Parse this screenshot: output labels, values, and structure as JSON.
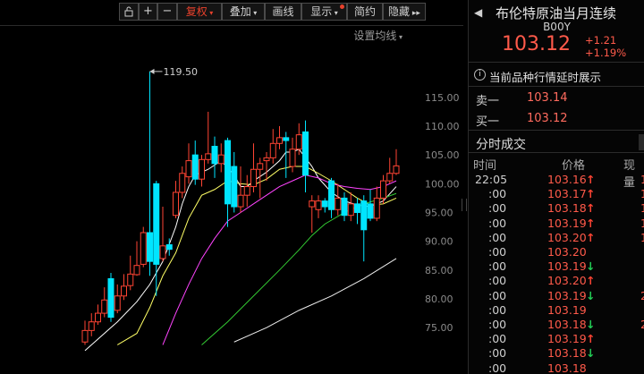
{
  "toolbar": {
    "buttons": [
      {
        "label": "复权",
        "has_menu": true,
        "active": true
      },
      {
        "label": "叠加",
        "has_menu": true
      },
      {
        "label": "画线",
        "has_menu": false
      },
      {
        "label": "显示",
        "has_menu": true,
        "dot": true
      },
      {
        "label": "简约",
        "has_menu": false
      },
      {
        "label": "隐藏",
        "has_menu": false
      }
    ],
    "icons": [
      "lock-icon",
      "plus-icon",
      "minus-icon"
    ],
    "collapse_icon": "double-chevron-right-icon",
    "avg_setting": "设置均线"
  },
  "colors": {
    "up": "#ff4433",
    "down": "#22cc55",
    "candle_up": "#ff4433",
    "candle_down": "#00e5ff",
    "ma5": "#ffffff",
    "ma10": "#ffff66",
    "ma20": "#ff44ff",
    "ma60": "#33cc33",
    "ma250": "#eeeeee"
  },
  "chart_data": {
    "type": "candlestick",
    "y_axis_labels": [
      "115.00",
      "110.00",
      "105.00",
      "100.00",
      "95.00",
      "90.00",
      "85.00",
      "80.00",
      "75.00"
    ],
    "ylim": [
      73,
      122
    ],
    "max_annotation": "119.50",
    "candles": [
      {
        "o": 72.5,
        "c": 74.5,
        "h": 76.2,
        "l": 72.0
      },
      {
        "o": 74.5,
        "c": 76.0,
        "h": 77.5,
        "l": 73.5
      },
      {
        "o": 76.0,
        "c": 77.5,
        "h": 79.0,
        "l": 75.5
      },
      {
        "o": 77.5,
        "c": 79.8,
        "h": 82.0,
        "l": 76.8
      },
      {
        "o": 83.5,
        "c": 76.8,
        "h": 84.5,
        "l": 76.0
      },
      {
        "o": 78.0,
        "c": 80.5,
        "h": 82.5,
        "l": 77.5
      },
      {
        "o": 80.5,
        "c": 82.2,
        "h": 84.3,
        "l": 79.8
      },
      {
        "o": 82.3,
        "c": 84.3,
        "h": 87.5,
        "l": 81.5
      },
      {
        "o": 84.2,
        "c": 85.8,
        "h": 90.0,
        "l": 84.0
      },
      {
        "o": 86.0,
        "c": 91.5,
        "h": 92.5,
        "l": 85.5
      },
      {
        "o": 91.5,
        "c": 86.5,
        "h": 119.5,
        "l": 84.0
      },
      {
        "o": 100.0,
        "c": 86.0,
        "h": 100.5,
        "l": 80.5
      },
      {
        "o": 87.0,
        "c": 89.2,
        "h": 96.0,
        "l": 86.5
      },
      {
        "o": 89.4,
        "c": 88.6,
        "h": 90.5,
        "l": 87.5
      },
      {
        "o": 94.5,
        "c": 98.5,
        "h": 100.5,
        "l": 94.0
      },
      {
        "o": 98.5,
        "c": 101.8,
        "h": 103.0,
        "l": 97.5
      },
      {
        "o": 101.2,
        "c": 104.0,
        "h": 107.0,
        "l": 100.0
      },
      {
        "o": 105.0,
        "c": 100.8,
        "h": 107.5,
        "l": 99.8
      },
      {
        "o": 100.8,
        "c": 104.2,
        "h": 105.0,
        "l": 99.5
      },
      {
        "o": 104.2,
        "c": 105.2,
        "h": 112.5,
        "l": 103.5
      },
      {
        "o": 106.5,
        "c": 103.5,
        "h": 108.2,
        "l": 101.0
      },
      {
        "o": 103.5,
        "c": 105.0,
        "h": 107.0,
        "l": 102.0
      },
      {
        "o": 107.5,
        "c": 96.5,
        "h": 108.0,
        "l": 92.5
      },
      {
        "o": 103.0,
        "c": 96.0,
        "h": 105.5,
        "l": 95.0
      },
      {
        "o": 96.0,
        "c": 98.0,
        "h": 103.0,
        "l": 95.0
      },
      {
        "o": 98.0,
        "c": 99.5,
        "h": 101.5,
        "l": 96.0
      },
      {
        "o": 99.5,
        "c": 102.5,
        "h": 107.0,
        "l": 98.5
      },
      {
        "o": 102.5,
        "c": 103.5,
        "h": 104.5,
        "l": 97.5
      },
      {
        "o": 104.0,
        "c": 104.5,
        "h": 105.5,
        "l": 100.5
      },
      {
        "o": 104.5,
        "c": 107.0,
        "h": 109.5,
        "l": 103.5
      },
      {
        "o": 107.0,
        "c": 108.0,
        "h": 110.0,
        "l": 106.0
      },
      {
        "o": 108.0,
        "c": 107.5,
        "h": 109.0,
        "l": 101.0
      },
      {
        "o": 103.0,
        "c": 106.0,
        "h": 108.0,
        "l": 102.0
      },
      {
        "o": 106.0,
        "c": 108.5,
        "h": 110.5,
        "l": 105.0
      },
      {
        "o": 109.0,
        "c": 101.5,
        "h": 111.0,
        "l": 98.5
      },
      {
        "o": 96.0,
        "c": 97.0,
        "h": 98.0,
        "l": 91.5
      },
      {
        "o": 95.5,
        "c": 97.0,
        "h": 98.0,
        "l": 94.0
      },
      {
        "o": 97.0,
        "c": 96.0,
        "h": 97.5,
        "l": 95.0
      },
      {
        "o": 100.5,
        "c": 95.5,
        "h": 101.0,
        "l": 94.0
      },
      {
        "o": 95.5,
        "c": 97.5,
        "h": 100.0,
        "l": 94.5
      },
      {
        "o": 97.5,
        "c": 94.5,
        "h": 98.5,
        "l": 93.5
      },
      {
        "o": 94.5,
        "c": 96.5,
        "h": 98.5,
        "l": 93.5
      },
      {
        "o": 96.5,
        "c": 95.0,
        "h": 97.5,
        "l": 93.0
      },
      {
        "o": 97.0,
        "c": 92.0,
        "h": 98.0,
        "l": 86.5
      },
      {
        "o": 96.5,
        "c": 94.0,
        "h": 99.0,
        "l": 93.5
      },
      {
        "o": 94.0,
        "c": 97.5,
        "h": 99.5,
        "l": 93.5
      },
      {
        "o": 97.5,
        "c": 100.5,
        "h": 101.5,
        "l": 96.5
      },
      {
        "o": 100.5,
        "c": 101.8,
        "h": 104.5,
        "l": 100.0
      },
      {
        "o": 101.8,
        "c": 103.1,
        "h": 106.0,
        "l": 101.5
      }
    ],
    "ma": [
      {
        "name": "MA5",
        "color": "#ffffff",
        "values": [
          [
            0,
            71.0
          ],
          [
            5,
            76.0
          ],
          [
            8,
            79.5
          ],
          [
            10,
            82.5
          ],
          [
            12,
            86.5
          ],
          [
            14,
            92.5
          ],
          [
            15,
            96.5
          ],
          [
            16,
            99.5
          ],
          [
            17,
            101.5
          ],
          [
            19,
            102.5
          ],
          [
            21,
            104.0
          ],
          [
            23,
            101.5
          ],
          [
            24,
            99.5
          ],
          [
            25,
            99.5
          ],
          [
            26,
            100.5
          ],
          [
            28,
            102.0
          ],
          [
            30,
            104.0
          ],
          [
            31,
            105.5
          ],
          [
            32,
            105.5
          ],
          [
            33,
            106.0
          ],
          [
            34,
            104.5
          ],
          [
            35,
            103.0
          ],
          [
            36,
            101.0
          ],
          [
            38,
            98.5
          ],
          [
            40,
            97.0
          ],
          [
            42,
            96.3
          ],
          [
            44,
            96.0
          ],
          [
            46,
            97.0
          ],
          [
            48,
            99.5
          ]
        ]
      },
      {
        "name": "MA10",
        "color": "#ffff66",
        "values": [
          [
            5,
            72.0
          ],
          [
            8,
            74.0
          ],
          [
            10,
            78.5
          ],
          [
            12,
            84.0
          ],
          [
            14,
            88.0
          ],
          [
            16,
            94.0
          ],
          [
            18,
            98.0
          ],
          [
            20,
            99.0
          ],
          [
            22,
            100.5
          ],
          [
            24,
            100.0
          ],
          [
            26,
            99.8
          ],
          [
            28,
            100.8
          ],
          [
            30,
            102.5
          ],
          [
            32,
            103.0
          ],
          [
            34,
            103.0
          ],
          [
            36,
            101.8
          ],
          [
            38,
            100.5
          ],
          [
            40,
            99.0
          ],
          [
            42,
            97.5
          ],
          [
            44,
            96.3
          ],
          [
            46,
            96.5
          ],
          [
            48,
            97.5
          ]
        ]
      },
      {
        "name": "MA20",
        "color": "#ff44ff",
        "values": [
          [
            12,
            72.0
          ],
          [
            14,
            77.5
          ],
          [
            16,
            82.5
          ],
          [
            18,
            87.0
          ],
          [
            20,
            90.5
          ],
          [
            22,
            93.5
          ],
          [
            24,
            95.0
          ],
          [
            26,
            96.5
          ],
          [
            28,
            98.0
          ],
          [
            30,
            99.5
          ],
          [
            32,
            100.5
          ],
          [
            34,
            101.5
          ],
          [
            36,
            101.0
          ],
          [
            38,
            100.0
          ],
          [
            40,
            99.5
          ],
          [
            42,
            99.2
          ],
          [
            44,
            99.0
          ],
          [
            46,
            99.5
          ],
          [
            48,
            100.5
          ]
        ]
      },
      {
        "name": "MA60",
        "color": "#33cc33",
        "values": [
          [
            18,
            72.0
          ],
          [
            22,
            76.0
          ],
          [
            26,
            80.5
          ],
          [
            30,
            85.0
          ],
          [
            33,
            88.5
          ],
          [
            35,
            91.0
          ],
          [
            37,
            93.0
          ],
          [
            40,
            95.0
          ],
          [
            43,
            96.5
          ],
          [
            46,
            97.5
          ],
          [
            48,
            98.3
          ]
        ]
      },
      {
        "name": "MA250",
        "color": "#eeeeee",
        "values": [
          [
            23,
            72.5
          ],
          [
            28,
            75.0
          ],
          [
            33,
            78.0
          ],
          [
            38,
            80.5
          ],
          [
            43,
            83.5
          ],
          [
            48,
            87.0
          ]
        ]
      }
    ]
  },
  "quote": {
    "name": "布伦特原油当月连续",
    "code": "B00Y",
    "price": "103.12",
    "change": "+1.21",
    "change_pct": "+1.19%",
    "delay_notice": "当前品种行情延时展示",
    "sell_label": "卖一",
    "sell_price": "103.14",
    "buy_label": "买一",
    "buy_price": "103.12",
    "ticks_title": "分时成交",
    "col_time": "时间",
    "col_price": "价格",
    "col_volume": "现量",
    "ticks": [
      {
        "time": "22:05",
        "price": "103.16",
        "dir": "up",
        "vol": "1"
      },
      {
        "time": ":00",
        "price": "103.17",
        "dir": "up",
        "vol": "1"
      },
      {
        "time": ":00",
        "price": "103.18",
        "dir": "up",
        "vol": "1"
      },
      {
        "time": ":00",
        "price": "103.19",
        "dir": "up",
        "vol": "1"
      },
      {
        "time": ":00",
        "price": "103.20",
        "dir": "up",
        "vol": "1"
      },
      {
        "time": ":00",
        "price": "103.20",
        "dir": "",
        "vol": ""
      },
      {
        "time": ":00",
        "price": "103.19",
        "dir": "down",
        "vol": ""
      },
      {
        "time": ":00",
        "price": "103.20",
        "dir": "up",
        "vol": ""
      },
      {
        "time": ":00",
        "price": "103.19",
        "dir": "down",
        "vol": "2"
      },
      {
        "time": ":00",
        "price": "103.19",
        "dir": "",
        "vol": ""
      },
      {
        "time": ":00",
        "price": "103.18",
        "dir": "down",
        "vol": "2"
      },
      {
        "time": ":00",
        "price": "103.19",
        "dir": "up",
        "vol": ""
      },
      {
        "time": ":00",
        "price": "103.18",
        "dir": "down",
        "vol": ""
      },
      {
        "time": ":00",
        "price": "103.18",
        "dir": "",
        "vol": ""
      }
    ]
  }
}
